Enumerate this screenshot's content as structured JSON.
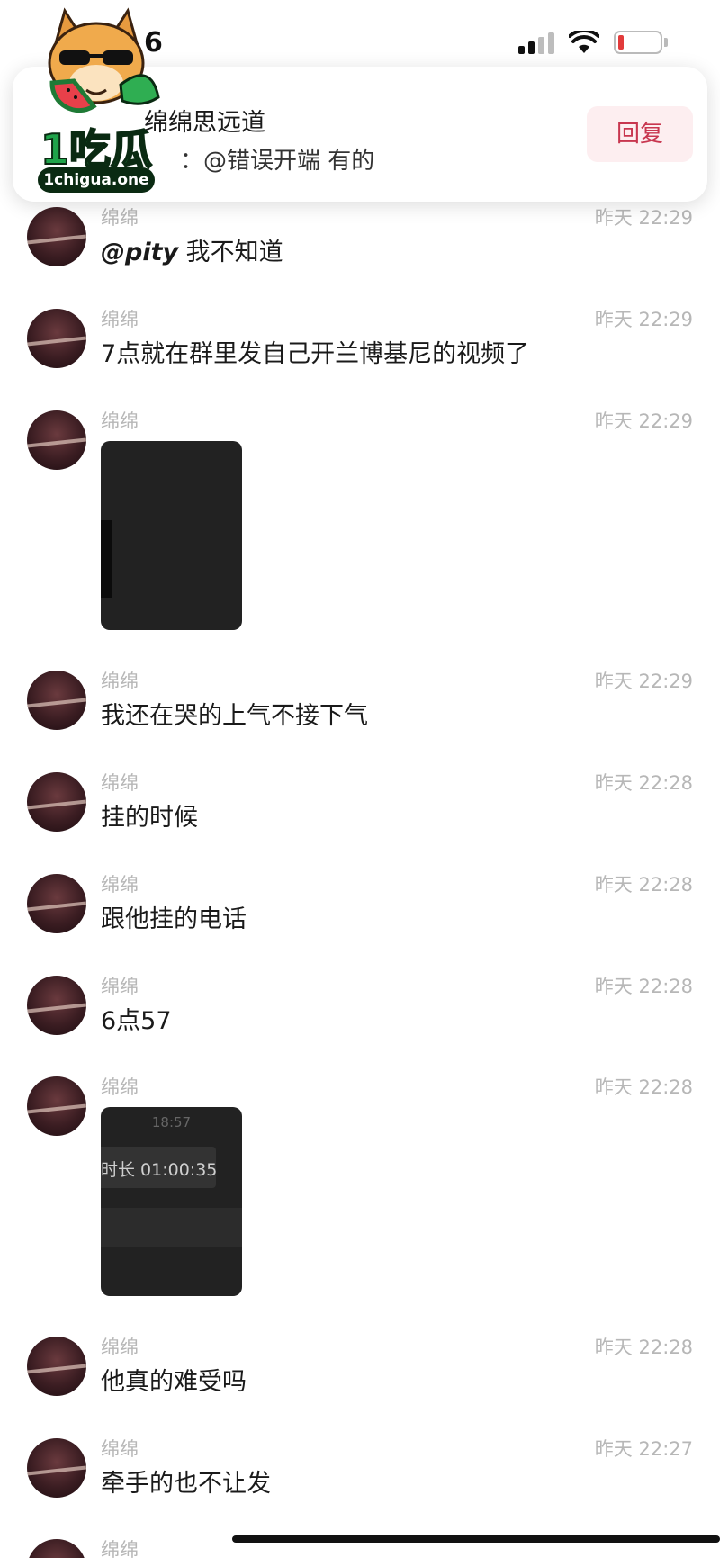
{
  "status_bar": {
    "time_fragment": "6"
  },
  "watermark": {
    "text": "1吃瓜",
    "url": "1chigua.one"
  },
  "notification": {
    "title": "绵绵思远道",
    "prefix": "：",
    "body": "@错误开端 有的",
    "reply_label": "回复"
  },
  "colors": {
    "reply_bg": "#fdeef0",
    "reply_text": "#c8364f",
    "battery_low": "#e23b3b"
  },
  "messages": [
    {
      "sender": "绵绵",
      "time": "昨天 22:29",
      "mention": "@pity",
      "text": " 我不知道"
    },
    {
      "sender": "绵绵",
      "time": "昨天 22:29",
      "text": "7点就在群里发自己开兰博基尼的视频了"
    },
    {
      "sender": "绵绵",
      "time": "昨天 22:29",
      "type": "image"
    },
    {
      "sender": "绵绵",
      "time": "昨天 22:29",
      "text": "我还在哭的上气不接下气"
    },
    {
      "sender": "绵绵",
      "time": "昨天 22:28",
      "text": "挂的时候"
    },
    {
      "sender": "绵绵",
      "time": "昨天 22:28",
      "text": "跟他挂的电话"
    },
    {
      "sender": "绵绵",
      "time": "昨天 22:28",
      "text": "6点57"
    },
    {
      "sender": "绵绵",
      "time": "昨天 22:28",
      "type": "image",
      "image_time": "18:57",
      "image_duration": "时长 01:00:35"
    },
    {
      "sender": "绵绵",
      "time": "昨天 22:28",
      "text": "他真的难受吗"
    },
    {
      "sender": "绵绵",
      "time": "昨天 22:27",
      "text": "牵手的也不让发"
    },
    {
      "sender": "绵绵"
    }
  ]
}
